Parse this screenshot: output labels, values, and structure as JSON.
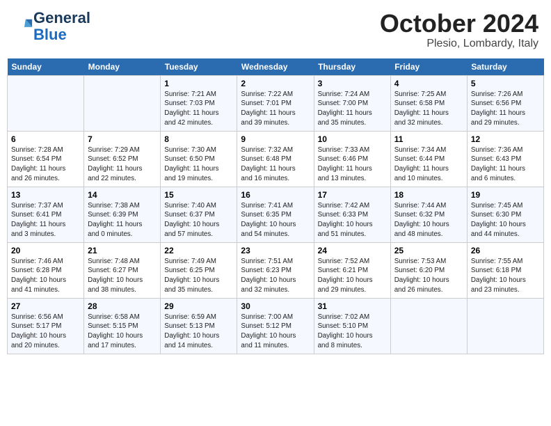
{
  "logo": {
    "line1": "General",
    "line2": "Blue"
  },
  "title": "October 2024",
  "location": "Plesio, Lombardy, Italy",
  "weekdays": [
    "Sunday",
    "Monday",
    "Tuesday",
    "Wednesday",
    "Thursday",
    "Friday",
    "Saturday"
  ],
  "weeks": [
    [
      {
        "day": "",
        "info": ""
      },
      {
        "day": "",
        "info": ""
      },
      {
        "day": "1",
        "info": "Sunrise: 7:21 AM\nSunset: 7:03 PM\nDaylight: 11 hours\nand 42 minutes."
      },
      {
        "day": "2",
        "info": "Sunrise: 7:22 AM\nSunset: 7:01 PM\nDaylight: 11 hours\nand 39 minutes."
      },
      {
        "day": "3",
        "info": "Sunrise: 7:24 AM\nSunset: 7:00 PM\nDaylight: 11 hours\nand 35 minutes."
      },
      {
        "day": "4",
        "info": "Sunrise: 7:25 AM\nSunset: 6:58 PM\nDaylight: 11 hours\nand 32 minutes."
      },
      {
        "day": "5",
        "info": "Sunrise: 7:26 AM\nSunset: 6:56 PM\nDaylight: 11 hours\nand 29 minutes."
      }
    ],
    [
      {
        "day": "6",
        "info": "Sunrise: 7:28 AM\nSunset: 6:54 PM\nDaylight: 11 hours\nand 26 minutes."
      },
      {
        "day": "7",
        "info": "Sunrise: 7:29 AM\nSunset: 6:52 PM\nDaylight: 11 hours\nand 22 minutes."
      },
      {
        "day": "8",
        "info": "Sunrise: 7:30 AM\nSunset: 6:50 PM\nDaylight: 11 hours\nand 19 minutes."
      },
      {
        "day": "9",
        "info": "Sunrise: 7:32 AM\nSunset: 6:48 PM\nDaylight: 11 hours\nand 16 minutes."
      },
      {
        "day": "10",
        "info": "Sunrise: 7:33 AM\nSunset: 6:46 PM\nDaylight: 11 hours\nand 13 minutes."
      },
      {
        "day": "11",
        "info": "Sunrise: 7:34 AM\nSunset: 6:44 PM\nDaylight: 11 hours\nand 10 minutes."
      },
      {
        "day": "12",
        "info": "Sunrise: 7:36 AM\nSunset: 6:43 PM\nDaylight: 11 hours\nand 6 minutes."
      }
    ],
    [
      {
        "day": "13",
        "info": "Sunrise: 7:37 AM\nSunset: 6:41 PM\nDaylight: 11 hours\nand 3 minutes."
      },
      {
        "day": "14",
        "info": "Sunrise: 7:38 AM\nSunset: 6:39 PM\nDaylight: 11 hours\nand 0 minutes."
      },
      {
        "day": "15",
        "info": "Sunrise: 7:40 AM\nSunset: 6:37 PM\nDaylight: 10 hours\nand 57 minutes."
      },
      {
        "day": "16",
        "info": "Sunrise: 7:41 AM\nSunset: 6:35 PM\nDaylight: 10 hours\nand 54 minutes."
      },
      {
        "day": "17",
        "info": "Sunrise: 7:42 AM\nSunset: 6:33 PM\nDaylight: 10 hours\nand 51 minutes."
      },
      {
        "day": "18",
        "info": "Sunrise: 7:44 AM\nSunset: 6:32 PM\nDaylight: 10 hours\nand 48 minutes."
      },
      {
        "day": "19",
        "info": "Sunrise: 7:45 AM\nSunset: 6:30 PM\nDaylight: 10 hours\nand 44 minutes."
      }
    ],
    [
      {
        "day": "20",
        "info": "Sunrise: 7:46 AM\nSunset: 6:28 PM\nDaylight: 10 hours\nand 41 minutes."
      },
      {
        "day": "21",
        "info": "Sunrise: 7:48 AM\nSunset: 6:27 PM\nDaylight: 10 hours\nand 38 minutes."
      },
      {
        "day": "22",
        "info": "Sunrise: 7:49 AM\nSunset: 6:25 PM\nDaylight: 10 hours\nand 35 minutes."
      },
      {
        "day": "23",
        "info": "Sunrise: 7:51 AM\nSunset: 6:23 PM\nDaylight: 10 hours\nand 32 minutes."
      },
      {
        "day": "24",
        "info": "Sunrise: 7:52 AM\nSunset: 6:21 PM\nDaylight: 10 hours\nand 29 minutes."
      },
      {
        "day": "25",
        "info": "Sunrise: 7:53 AM\nSunset: 6:20 PM\nDaylight: 10 hours\nand 26 minutes."
      },
      {
        "day": "26",
        "info": "Sunrise: 7:55 AM\nSunset: 6:18 PM\nDaylight: 10 hours\nand 23 minutes."
      }
    ],
    [
      {
        "day": "27",
        "info": "Sunrise: 6:56 AM\nSunset: 5:17 PM\nDaylight: 10 hours\nand 20 minutes."
      },
      {
        "day": "28",
        "info": "Sunrise: 6:58 AM\nSunset: 5:15 PM\nDaylight: 10 hours\nand 17 minutes."
      },
      {
        "day": "29",
        "info": "Sunrise: 6:59 AM\nSunset: 5:13 PM\nDaylight: 10 hours\nand 14 minutes."
      },
      {
        "day": "30",
        "info": "Sunrise: 7:00 AM\nSunset: 5:12 PM\nDaylight: 10 hours\nand 11 minutes."
      },
      {
        "day": "31",
        "info": "Sunrise: 7:02 AM\nSunset: 5:10 PM\nDaylight: 10 hours\nand 8 minutes."
      },
      {
        "day": "",
        "info": ""
      },
      {
        "day": "",
        "info": ""
      }
    ]
  ]
}
